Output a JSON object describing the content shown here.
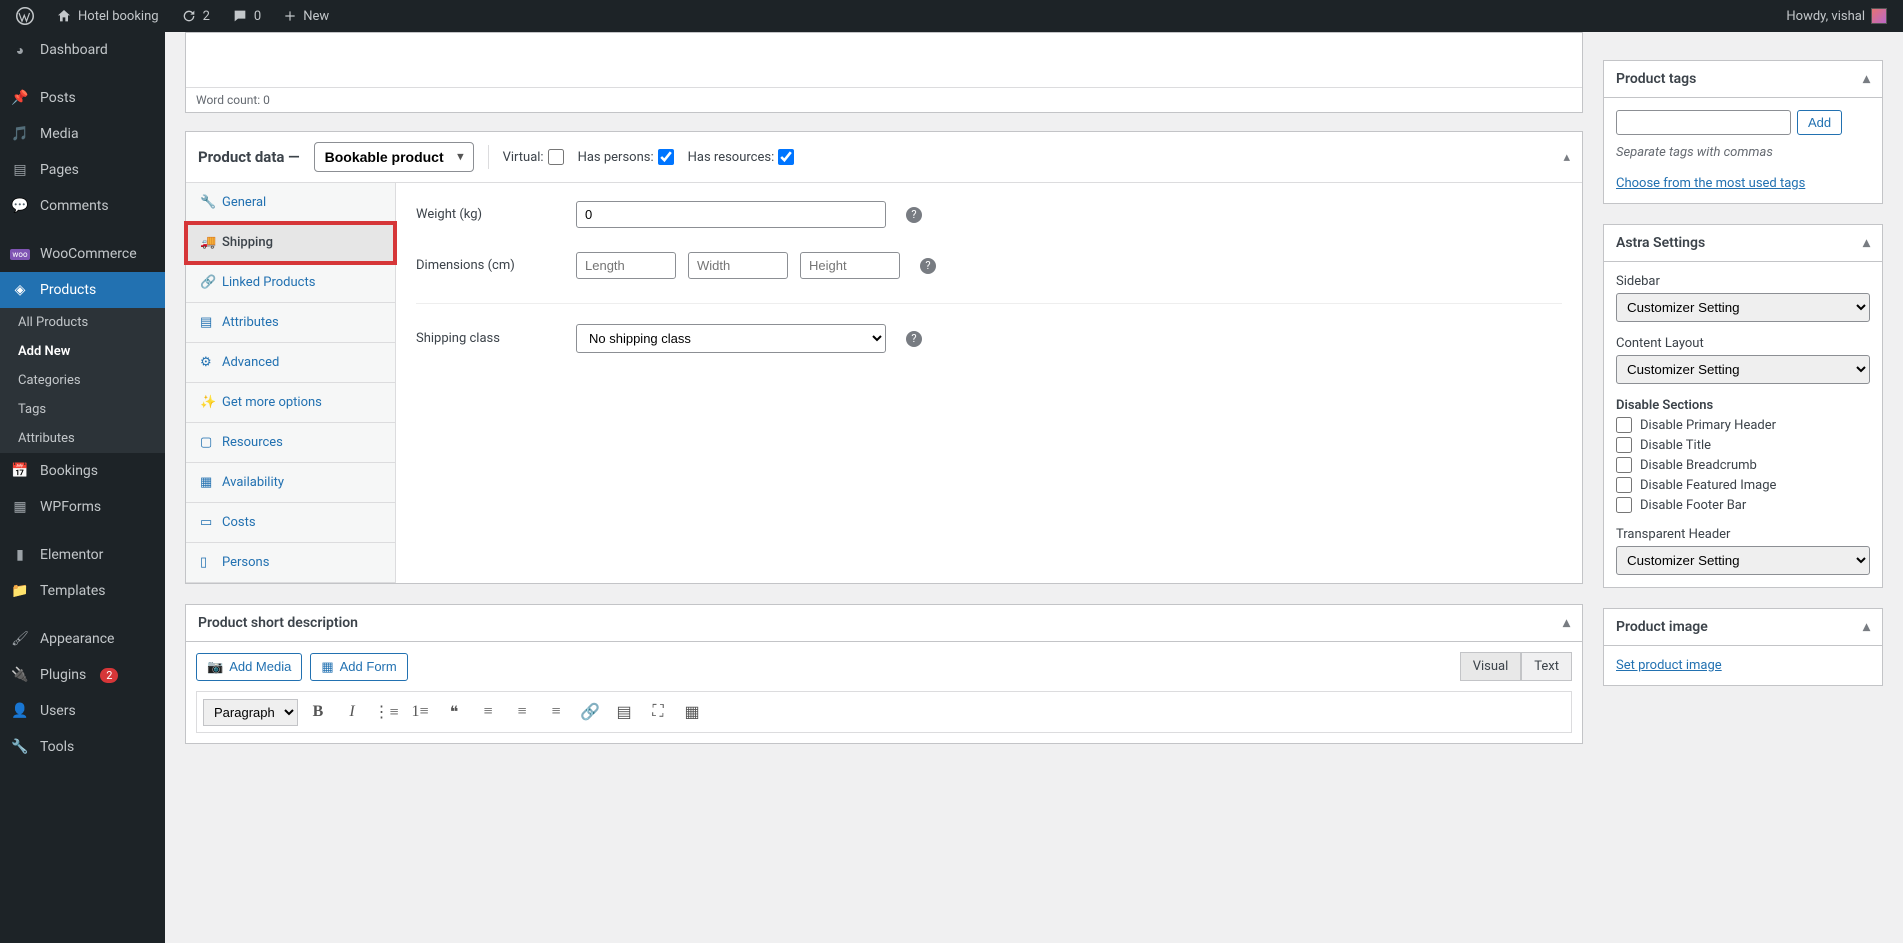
{
  "adminbar": {
    "site_title": "Hotel booking",
    "updates_count": "2",
    "comments_count": "0",
    "new_label": "New",
    "howdy": "Howdy, vishal"
  },
  "sidebar": {
    "items": [
      {
        "label": "Dashboard",
        "icon": "dashboard"
      },
      {
        "label": "Posts",
        "icon": "pin"
      },
      {
        "label": "Media",
        "icon": "media"
      },
      {
        "label": "Pages",
        "icon": "page"
      },
      {
        "label": "Comments",
        "icon": "comment"
      },
      {
        "label": "WooCommerce",
        "icon": "woo"
      },
      {
        "label": "Products",
        "icon": "product"
      },
      {
        "label": "Bookings",
        "icon": "calendar"
      },
      {
        "label": "WPForms",
        "icon": "form"
      },
      {
        "label": "Elementor",
        "icon": "elementor"
      },
      {
        "label": "Templates",
        "icon": "folder"
      },
      {
        "label": "Appearance",
        "icon": "brush"
      },
      {
        "label": "Plugins",
        "icon": "plugin"
      },
      {
        "label": "Users",
        "icon": "user"
      },
      {
        "label": "Tools",
        "icon": "tool"
      }
    ],
    "plugins_badge": "2",
    "products_sub": [
      "All Products",
      "Add New",
      "Categories",
      "Tags",
      "Attributes"
    ],
    "products_sub_current": "Add New"
  },
  "editor": {
    "word_count": "Word count: 0"
  },
  "product_data": {
    "title": "Product data —",
    "type": "Bookable product",
    "opts": {
      "virtual": "Virtual:",
      "has_persons": "Has persons:",
      "has_resources": "Has resources:"
    },
    "tabs": [
      "General",
      "Shipping",
      "Linked Products",
      "Attributes",
      "Advanced",
      "Get more options",
      "Resources",
      "Availability",
      "Costs",
      "Persons"
    ],
    "active_tab": "Shipping",
    "shipping": {
      "weight_label": "Weight (kg)",
      "weight_value": "0",
      "dimensions_label": "Dimensions (cm)",
      "length_ph": "Length",
      "width_ph": "Width",
      "height_ph": "Height",
      "class_label": "Shipping class",
      "class_value": "No shipping class"
    }
  },
  "short_desc": {
    "title": "Product short description",
    "add_media": "Add Media",
    "add_form": "Add Form",
    "visual": "Visual",
    "text": "Text",
    "format": "Paragraph"
  },
  "tags": {
    "title": "Product tags",
    "add": "Add",
    "separate": "Separate tags with commas",
    "choose": "Choose from the most used tags"
  },
  "astra": {
    "title": "Astra Settings",
    "sidebar_label": "Sidebar",
    "sidebar_value": "Customizer Setting",
    "layout_label": "Content Layout",
    "layout_value": "Customizer Setting",
    "disable_label": "Disable Sections",
    "disable": [
      "Disable Primary Header",
      "Disable Title",
      "Disable Breadcrumb",
      "Disable Featured Image",
      "Disable Footer Bar"
    ],
    "trans_label": "Transparent Header",
    "trans_value": "Customizer Setting"
  },
  "product_image": {
    "title": "Product image",
    "set": "Set product image"
  }
}
